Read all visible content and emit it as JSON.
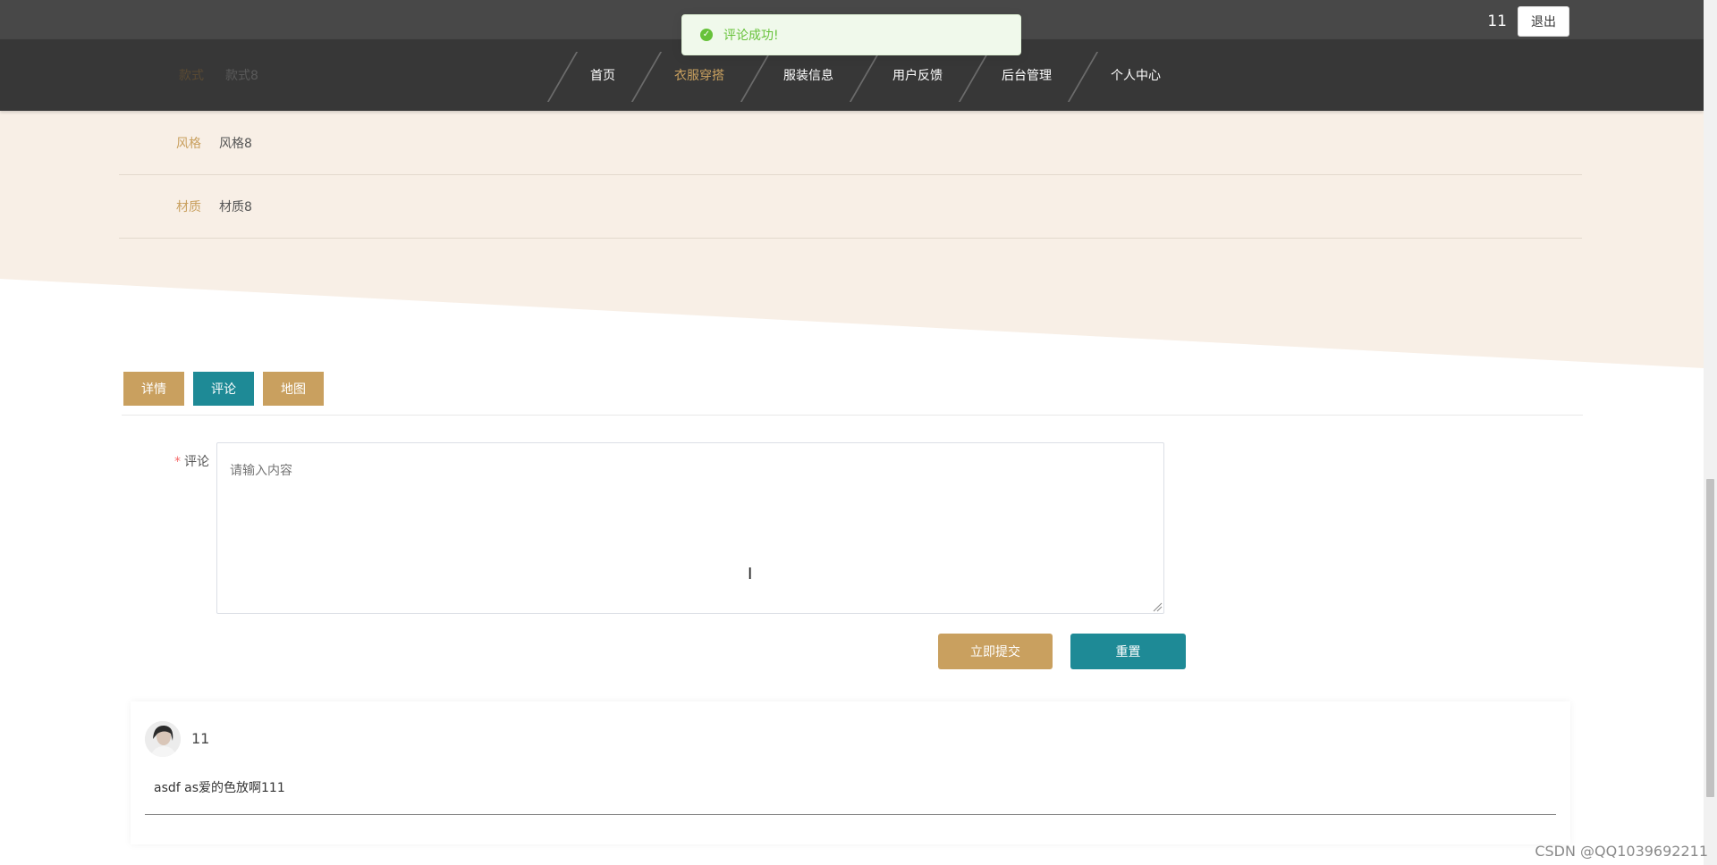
{
  "header": {
    "username": "11",
    "logout_label": "退出",
    "nav": [
      {
        "label": "首页",
        "active": false
      },
      {
        "label": "衣服穿搭",
        "active": true
      },
      {
        "label": "服装信息",
        "active": false
      },
      {
        "label": "用户反馈",
        "active": false
      },
      {
        "label": "后台管理",
        "active": false
      },
      {
        "label": "个人中心",
        "active": false
      }
    ]
  },
  "toast": {
    "message": "评论成功!"
  },
  "details": [
    {
      "label": "款式",
      "value": "款式8"
    },
    {
      "label": "风格",
      "value": "风格8"
    },
    {
      "label": "材质",
      "value": "材质8"
    }
  ],
  "tabs": [
    {
      "label": "详情",
      "active": false
    },
    {
      "label": "评论",
      "active": true
    },
    {
      "label": "地图",
      "active": false
    }
  ],
  "comment_form": {
    "label": "评论",
    "required_mark": "*",
    "placeholder": "请输入内容",
    "submit_label": "立即提交",
    "reset_label": "重置"
  },
  "comments": [
    {
      "user": "11",
      "content": "asdf as爱的色放啊111"
    }
  ],
  "watermark": "CSDN @QQ1039692211",
  "colors": {
    "accent_gold": "#c9a05f",
    "accent_teal": "#1e8a96",
    "nav_bg": "#373737",
    "beige_bg": "#f8efe6",
    "toast_green": "#67c23a"
  }
}
